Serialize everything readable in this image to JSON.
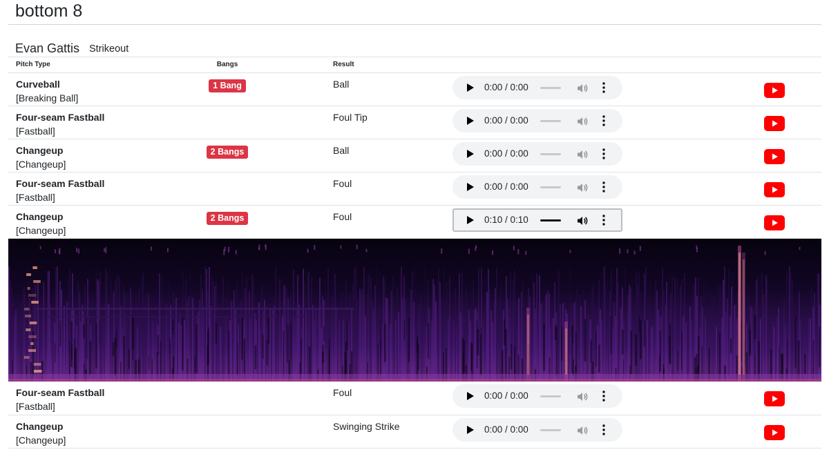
{
  "inning": "bottom 8",
  "at_bat": {
    "batter": "Evan Gattis",
    "result": "Strikeout"
  },
  "columns": {
    "pitch_type": "Pitch Type",
    "bangs": "Bangs",
    "result": "Result"
  },
  "pitches": [
    {
      "type": "Curveball",
      "category": "[Breaking Ball]",
      "bangs": "1 Bang",
      "result": "Ball",
      "audio_time": "0:00 / 0:00",
      "audio_state": "idle"
    },
    {
      "type": "Four-seam Fastball",
      "category": "[Fastball]",
      "bangs": "",
      "result": "Foul Tip",
      "audio_time": "0:00 / 0:00",
      "audio_state": "idle"
    },
    {
      "type": "Changeup",
      "category": "[Changeup]",
      "bangs": "2 Bangs",
      "result": "Ball",
      "audio_time": "0:00 / 0:00",
      "audio_state": "idle"
    },
    {
      "type": "Four-seam Fastball",
      "category": "[Fastball]",
      "bangs": "",
      "result": "Foul",
      "audio_time": "0:00 / 0:00",
      "audio_state": "idle"
    },
    {
      "type": "Changeup",
      "category": "[Changeup]",
      "bangs": "2 Bangs",
      "result": "Foul",
      "audio_time": "0:10 / 0:10",
      "audio_state": "loaded",
      "spectrogram": true
    },
    {
      "type": "Four-seam Fastball",
      "category": "[Fastball]",
      "bangs": "",
      "result": "Foul",
      "audio_time": "0:00 / 0:00",
      "audio_state": "idle"
    },
    {
      "type": "Changeup",
      "category": "[Changeup]",
      "bangs": "",
      "result": "Swinging Strike",
      "audio_time": "0:00 / 0:00",
      "audio_state": "idle"
    }
  ],
  "colors": {
    "badge": "#dc3545",
    "youtube": "#ff0000",
    "spectrogram_bg": "#07030f",
    "spectrogram_mid": "#5a1f8a",
    "spectrogram_hot": "#f0a080"
  },
  "icons": {
    "play": "play-icon",
    "volume": "volume-icon",
    "menu": "kebab-menu-icon",
    "video": "youtube-icon"
  }
}
